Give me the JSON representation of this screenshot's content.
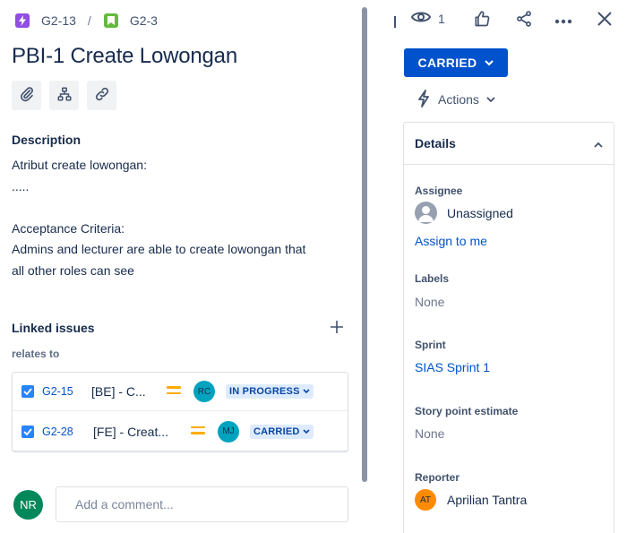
{
  "breadcrumb": {
    "epic_key": "G2-13",
    "separator": "/",
    "story_key": "G2-3"
  },
  "issue": {
    "title": "PBI-1 Create Lowongan"
  },
  "toolbar_icons": [
    "attachment-icon",
    "child-issue-icon",
    "link-icon"
  ],
  "description": {
    "label": "Description",
    "lines": [
      "Atribut create lowongan:",
      ".....",
      "",
      "Acceptance Criteria:",
      "Admins and lecturer are able to create lowongan that",
      "all other roles can see"
    ]
  },
  "linked_issues": {
    "label": "Linked issues",
    "relation": "relates to",
    "items": [
      {
        "key": "G2-15",
        "summary": "[BE] - C...",
        "priority": "medium",
        "assignee_initials": "RC",
        "status": "IN PROGRESS"
      },
      {
        "key": "G2-28",
        "summary": "[FE] - Creat...",
        "priority": "medium",
        "assignee_initials": "MJ",
        "status": "CARRIED"
      }
    ]
  },
  "comment": {
    "user_initials": "NR",
    "placeholder": "Add a comment..."
  },
  "header_actions": {
    "watchers_count": "1",
    "icons": [
      "eye-icon",
      "thumbs-up-icon",
      "share-icon",
      "more-icon",
      "close-icon"
    ]
  },
  "status_button": {
    "label": "CARRIED"
  },
  "actions_button": {
    "label": "Actions"
  },
  "details": {
    "title": "Details",
    "assignee": {
      "label": "Assignee",
      "value": "Unassigned",
      "assign_link": "Assign to me"
    },
    "labels": {
      "label": "Labels",
      "value": "None"
    },
    "sprint": {
      "label": "Sprint",
      "value": "SIAS Sprint 1"
    },
    "story_points": {
      "label": "Story point estimate",
      "value": "None"
    },
    "reporter": {
      "label": "Reporter",
      "initials": "AT",
      "name": "Aprilian Tantra"
    }
  },
  "colors": {
    "primary": "#0052cc",
    "status_lozenge_bg": "#deebff",
    "epic": "#904ee2",
    "story": "#63ba3c",
    "priority_medium": "#ffab00"
  }
}
